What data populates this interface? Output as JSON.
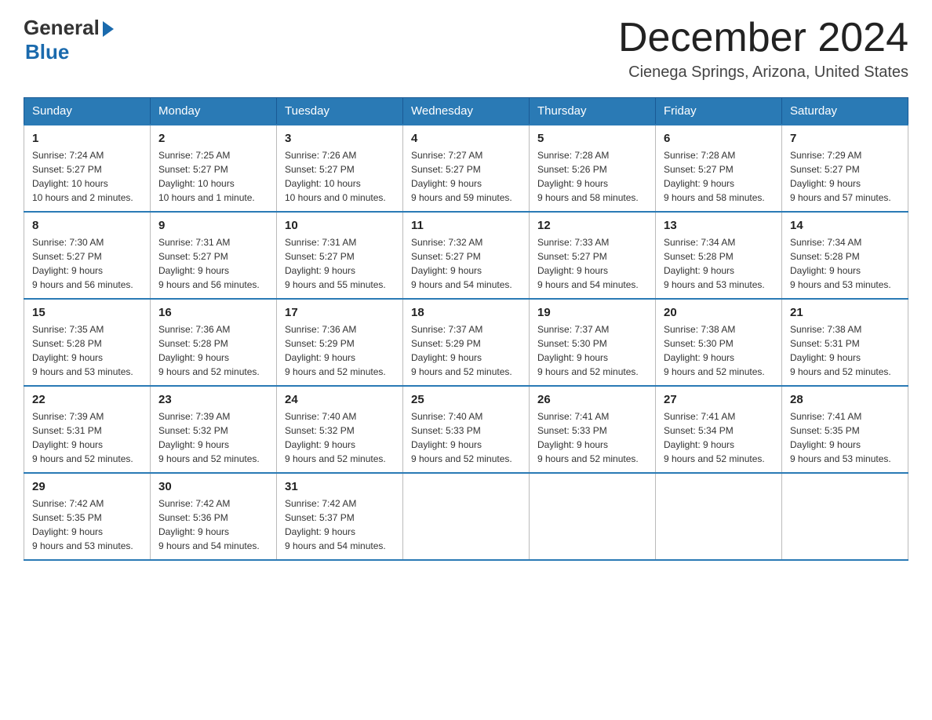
{
  "header": {
    "logo_general": "General",
    "logo_blue": "Blue",
    "month_title": "December 2024",
    "location": "Cienega Springs, Arizona, United States"
  },
  "days_of_week": [
    "Sunday",
    "Monday",
    "Tuesday",
    "Wednesday",
    "Thursday",
    "Friday",
    "Saturday"
  ],
  "weeks": [
    [
      {
        "day": "1",
        "sunrise": "7:24 AM",
        "sunset": "5:27 PM",
        "daylight": "10 hours and 2 minutes."
      },
      {
        "day": "2",
        "sunrise": "7:25 AM",
        "sunset": "5:27 PM",
        "daylight": "10 hours and 1 minute."
      },
      {
        "day": "3",
        "sunrise": "7:26 AM",
        "sunset": "5:27 PM",
        "daylight": "10 hours and 0 minutes."
      },
      {
        "day": "4",
        "sunrise": "7:27 AM",
        "sunset": "5:27 PM",
        "daylight": "9 hours and 59 minutes."
      },
      {
        "day": "5",
        "sunrise": "7:28 AM",
        "sunset": "5:26 PM",
        "daylight": "9 hours and 58 minutes."
      },
      {
        "day": "6",
        "sunrise": "7:28 AM",
        "sunset": "5:27 PM",
        "daylight": "9 hours and 58 minutes."
      },
      {
        "day": "7",
        "sunrise": "7:29 AM",
        "sunset": "5:27 PM",
        "daylight": "9 hours and 57 minutes."
      }
    ],
    [
      {
        "day": "8",
        "sunrise": "7:30 AM",
        "sunset": "5:27 PM",
        "daylight": "9 hours and 56 minutes."
      },
      {
        "day": "9",
        "sunrise": "7:31 AM",
        "sunset": "5:27 PM",
        "daylight": "9 hours and 56 minutes."
      },
      {
        "day": "10",
        "sunrise": "7:31 AM",
        "sunset": "5:27 PM",
        "daylight": "9 hours and 55 minutes."
      },
      {
        "day": "11",
        "sunrise": "7:32 AM",
        "sunset": "5:27 PM",
        "daylight": "9 hours and 54 minutes."
      },
      {
        "day": "12",
        "sunrise": "7:33 AM",
        "sunset": "5:27 PM",
        "daylight": "9 hours and 54 minutes."
      },
      {
        "day": "13",
        "sunrise": "7:34 AM",
        "sunset": "5:28 PM",
        "daylight": "9 hours and 53 minutes."
      },
      {
        "day": "14",
        "sunrise": "7:34 AM",
        "sunset": "5:28 PM",
        "daylight": "9 hours and 53 minutes."
      }
    ],
    [
      {
        "day": "15",
        "sunrise": "7:35 AM",
        "sunset": "5:28 PM",
        "daylight": "9 hours and 53 minutes."
      },
      {
        "day": "16",
        "sunrise": "7:36 AM",
        "sunset": "5:28 PM",
        "daylight": "9 hours and 52 minutes."
      },
      {
        "day": "17",
        "sunrise": "7:36 AM",
        "sunset": "5:29 PM",
        "daylight": "9 hours and 52 minutes."
      },
      {
        "day": "18",
        "sunrise": "7:37 AM",
        "sunset": "5:29 PM",
        "daylight": "9 hours and 52 minutes."
      },
      {
        "day": "19",
        "sunrise": "7:37 AM",
        "sunset": "5:30 PM",
        "daylight": "9 hours and 52 minutes."
      },
      {
        "day": "20",
        "sunrise": "7:38 AM",
        "sunset": "5:30 PM",
        "daylight": "9 hours and 52 minutes."
      },
      {
        "day": "21",
        "sunrise": "7:38 AM",
        "sunset": "5:31 PM",
        "daylight": "9 hours and 52 minutes."
      }
    ],
    [
      {
        "day": "22",
        "sunrise": "7:39 AM",
        "sunset": "5:31 PM",
        "daylight": "9 hours and 52 minutes."
      },
      {
        "day": "23",
        "sunrise": "7:39 AM",
        "sunset": "5:32 PM",
        "daylight": "9 hours and 52 minutes."
      },
      {
        "day": "24",
        "sunrise": "7:40 AM",
        "sunset": "5:32 PM",
        "daylight": "9 hours and 52 minutes."
      },
      {
        "day": "25",
        "sunrise": "7:40 AM",
        "sunset": "5:33 PM",
        "daylight": "9 hours and 52 minutes."
      },
      {
        "day": "26",
        "sunrise": "7:41 AM",
        "sunset": "5:33 PM",
        "daylight": "9 hours and 52 minutes."
      },
      {
        "day": "27",
        "sunrise": "7:41 AM",
        "sunset": "5:34 PM",
        "daylight": "9 hours and 52 minutes."
      },
      {
        "day": "28",
        "sunrise": "7:41 AM",
        "sunset": "5:35 PM",
        "daylight": "9 hours and 53 minutes."
      }
    ],
    [
      {
        "day": "29",
        "sunrise": "7:42 AM",
        "sunset": "5:35 PM",
        "daylight": "9 hours and 53 minutes."
      },
      {
        "day": "30",
        "sunrise": "7:42 AM",
        "sunset": "5:36 PM",
        "daylight": "9 hours and 54 minutes."
      },
      {
        "day": "31",
        "sunrise": "7:42 AM",
        "sunset": "5:37 PM",
        "daylight": "9 hours and 54 minutes."
      },
      null,
      null,
      null,
      null
    ]
  ],
  "labels": {
    "sunrise": "Sunrise:",
    "sunset": "Sunset:",
    "daylight": "Daylight:"
  }
}
